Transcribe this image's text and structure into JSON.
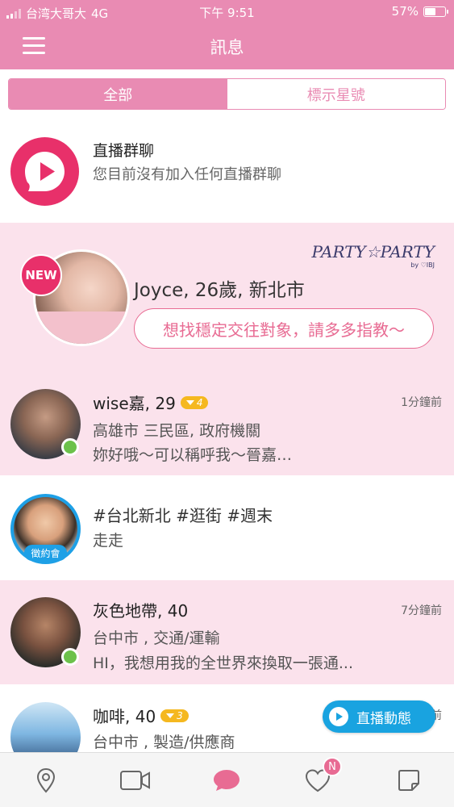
{
  "status_bar": {
    "carrier": "台湾大哥大",
    "network": "4G",
    "time": "下午 9:51",
    "battery": "57%",
    "battery_level": 0.57
  },
  "header": {
    "title": "訊息",
    "menu_icon": "hamburger-icon"
  },
  "segment": {
    "all": "全部",
    "starred": "標示星號"
  },
  "live_group": {
    "title": "直播群聊",
    "subtitle": "您目前沒有加入任何直播群聊",
    "icon": "live-chat-icon"
  },
  "promo": {
    "badge": "NEW",
    "brand": "PARTY☆PARTY",
    "brand_sub": "by ♡IBJ",
    "name": "Joyce, 26歲, 新北市",
    "cta": "想找穩定交往對象，請多多指教～"
  },
  "chats": [
    {
      "name": "wise嘉, 29",
      "vip_level": "4",
      "time": "1分鐘前",
      "line1": "高雄市 三民區, 政府機關",
      "line2": "妳好哦～可以稱呼我～晉嘉…",
      "online": true
    },
    {
      "tags": "#台北新北 #逛街 #週末",
      "line2": "走走",
      "label": "徵約會"
    },
    {
      "name": "灰色地帶, 40",
      "time": "7分鐘前",
      "line1": "台中市 , 交通/運輸",
      "line2": "HI，我想用我的全世界來換取一張通...",
      "online": true
    },
    {
      "name": "咖啡, 40",
      "vip_level": "3",
      "time": "前",
      "line1": "台中市 , 製造/供應商"
    }
  ],
  "fab": {
    "label": "直播動態"
  },
  "tabbar": {
    "items": [
      "location-pin-icon",
      "video-camera-icon",
      "chat-bubble-icon",
      "heart-icon",
      "note-icon"
    ],
    "likes_badge": "N"
  },
  "colors": {
    "brand_pink": "#e98bb3",
    "accent_pink": "#e8306a",
    "row_pink": "#fbe2ec",
    "online_green": "#6cc14a",
    "vip_gold": "#f5b81f",
    "fab_blue": "#19a3e0"
  }
}
